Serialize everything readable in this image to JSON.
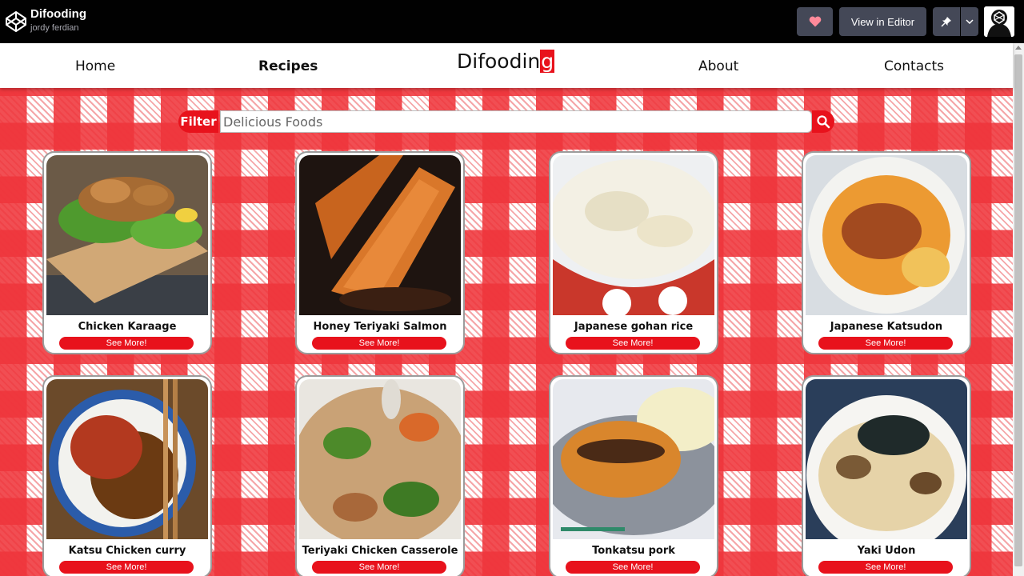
{
  "codepen": {
    "title": "Difooding",
    "author": "jordy ferdian",
    "view_in_editor": "View in Editor"
  },
  "nav": {
    "home": "Home",
    "recipes": "Recipes",
    "brand_main": "Difoodin",
    "brand_last": "g",
    "about": "About",
    "contacts": "Contacts"
  },
  "search": {
    "filter_label": "Filter",
    "placeholder": "Delicious Foods"
  },
  "recipes": [
    {
      "name": "Chicken Karaage",
      "button": "See More!"
    },
    {
      "name": "Honey Teriyaki Salmon",
      "button": "See More!"
    },
    {
      "name": "Japanese gohan rice",
      "button": "See More!"
    },
    {
      "name": "Japanese Katsudon",
      "button": "See More!"
    },
    {
      "name": "Katsu Chicken curry",
      "button": "See More!"
    },
    {
      "name": "Teriyaki Chicken Casserole",
      "button": "See More!"
    },
    {
      "name": "Tonkatsu pork",
      "button": "See More!"
    },
    {
      "name": "Yaki Udon",
      "button": "See More!"
    }
  ],
  "colors": {
    "accent": "#e8121c",
    "topbar": "#010101",
    "button": "#444857"
  }
}
